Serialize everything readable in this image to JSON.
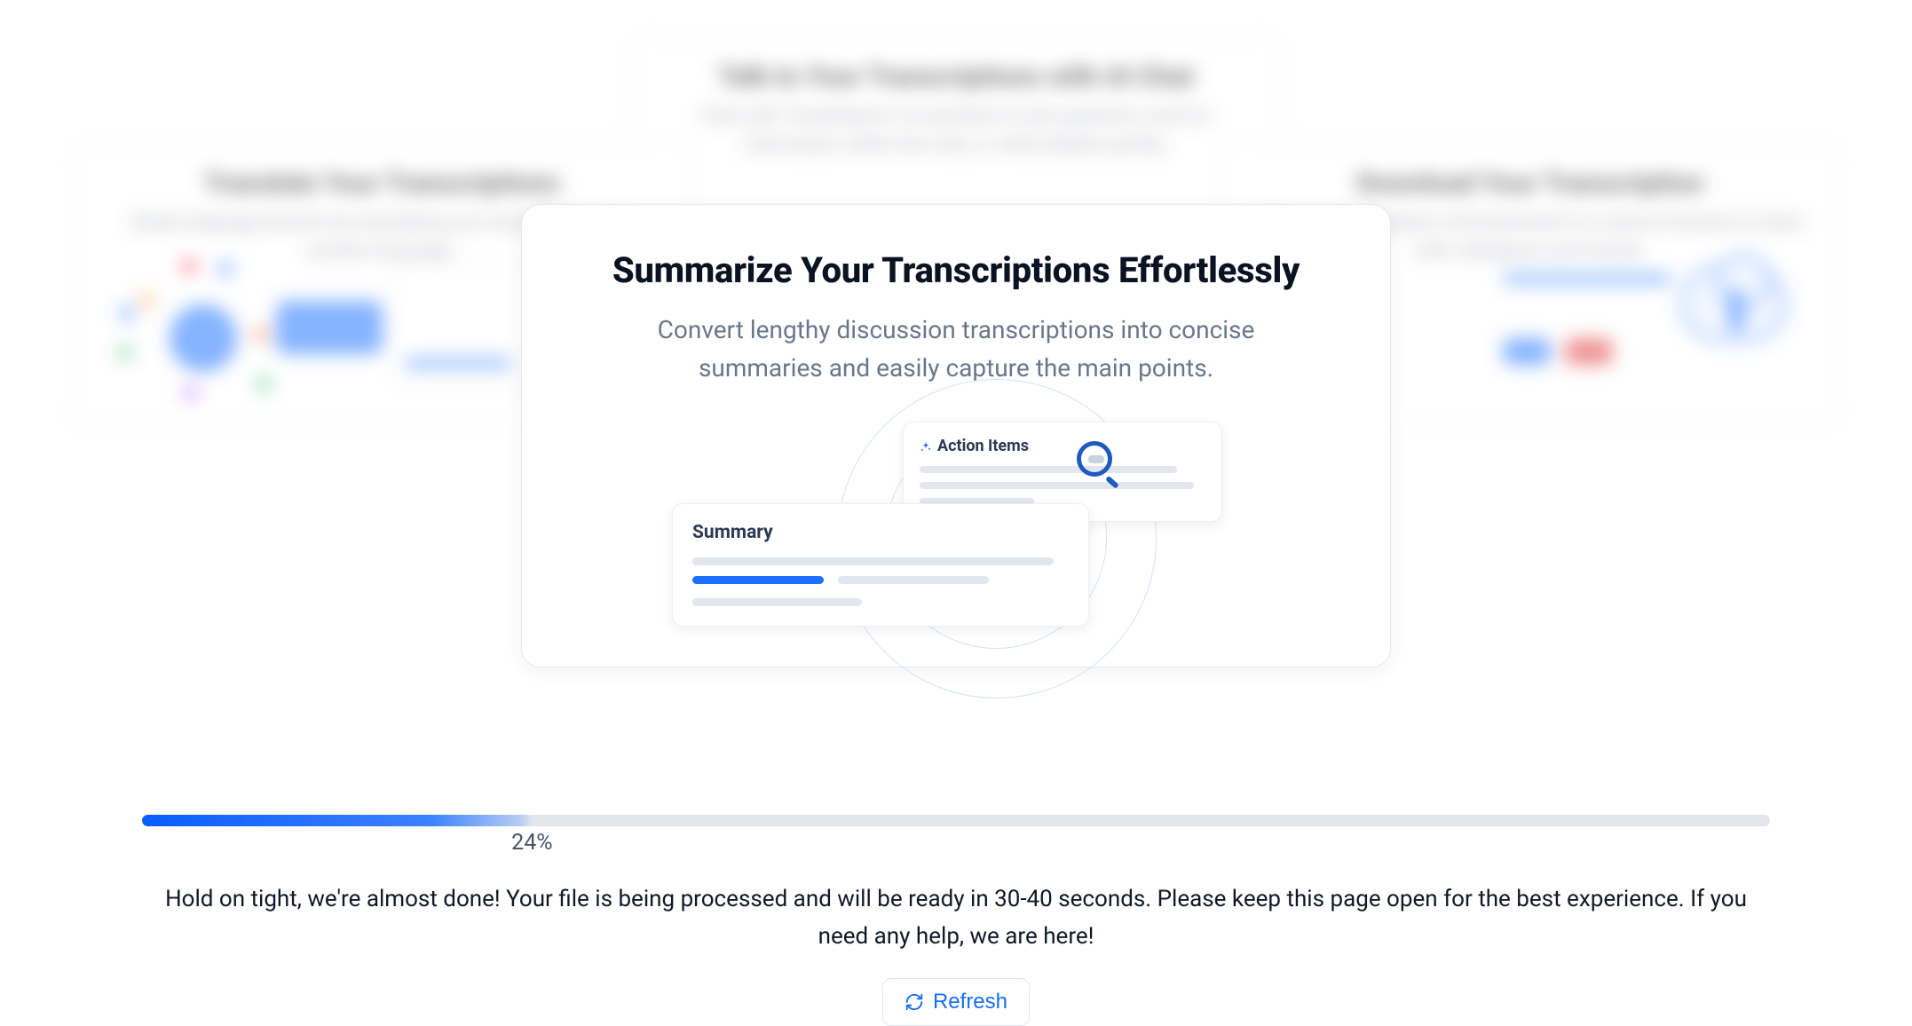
{
  "featured": {
    "title": "Summarize Your Transcriptions Effortlessly",
    "description": "Convert lengthy discussion transcriptions into concise summaries and easily capture the main points.",
    "illustration": {
      "summary_label": "Summary",
      "action_items_label": "Action Items"
    }
  },
  "background_cards": {
    "top": {
      "title": "Talk to Your Transcriptions with AI Chat",
      "description": "Chat with Transkriptor's AI assistant to ask questions, look for information within the chat, or verify details quickly."
    },
    "left": {
      "title": "Translate Your Transcriptions",
      "description": "Break language barriers by translating your transcription into another language."
    },
    "right": {
      "title": "Download Your Transcription",
      "description": "Edit your transcription and download it in various formats to share with colleagues and friends."
    }
  },
  "progress": {
    "percent": 24,
    "percent_label": "24%",
    "status_message": "Hold on tight, we're almost done! Your file is being processed and will be ready in 30-40 seconds. Please keep this page open for the best experience. If you need any help, we are here!"
  },
  "actions": {
    "refresh_label": "Refresh"
  }
}
